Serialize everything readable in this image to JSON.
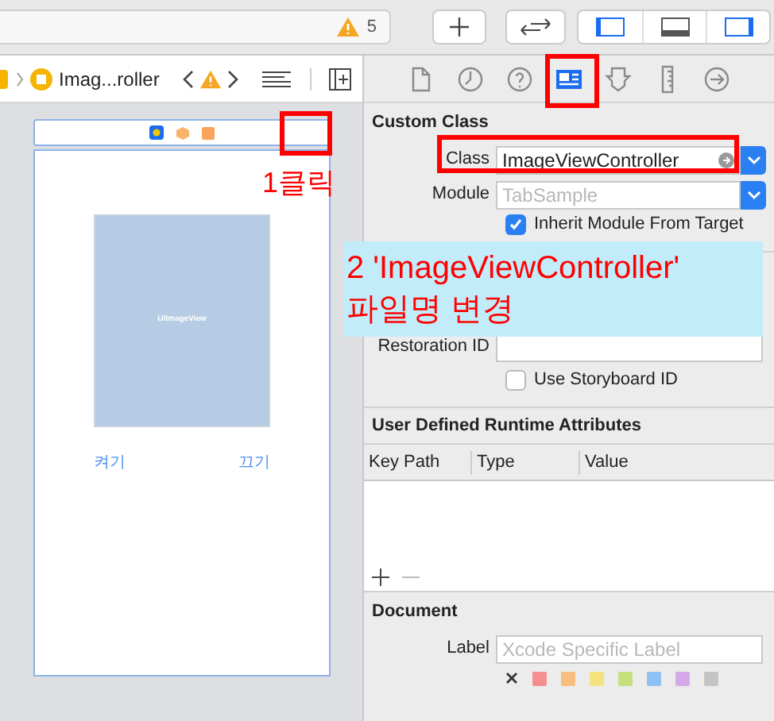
{
  "toolbar": {
    "warning_count": "5",
    "layout_toggles": [
      {
        "selected": true
      },
      {
        "selected": false
      },
      {
        "selected": true
      }
    ]
  },
  "jump_bar": {
    "path_item": "Imag...roller"
  },
  "inspector_tabs": [
    {
      "kind": "file",
      "selected": false
    },
    {
      "kind": "history",
      "selected": false
    },
    {
      "kind": "help",
      "selected": false
    },
    {
      "kind": "identity",
      "selected": true
    },
    {
      "kind": "attributes",
      "selected": false
    },
    {
      "kind": "size",
      "selected": false
    },
    {
      "kind": "connections",
      "selected": false
    }
  ],
  "canvas": {
    "image_view_label": "UIImageView",
    "buttons": [
      "켜기",
      "끄기"
    ]
  },
  "custom_class": {
    "title": "Custom Class",
    "class_label": "Class",
    "class_value": "ImageViewController",
    "module_label": "Module",
    "module_placeholder": "TabSample",
    "inherit_label": "Inherit Module From Target",
    "inherit_checked": true
  },
  "identity": {
    "restoration_label": "Restoration ID",
    "use_storyboard_label": "Use Storyboard ID",
    "use_storyboard_checked": false
  },
  "runtime_attributes": {
    "title": "User Defined Runtime Attributes",
    "columns": [
      "Key Path",
      "Type",
      "Value"
    ]
  },
  "document": {
    "title": "Document",
    "label_label": "Label",
    "label_placeholder": "Xcode Specific Label",
    "colors": [
      {
        "color": "#f58f8f"
      },
      {
        "color": "#f9bd7f"
      },
      {
        "color": "#f6e27c"
      },
      {
        "color": "#c5e07d"
      },
      {
        "color": "#8ec2f5"
      },
      {
        "color": "#d5a9e8"
      },
      {
        "color": "#c4c4c4"
      }
    ]
  },
  "annotations": {
    "step1": "1클릭",
    "step2_line1": "2 'ImageViewController'",
    "step2_line2": "파일명 변경"
  }
}
